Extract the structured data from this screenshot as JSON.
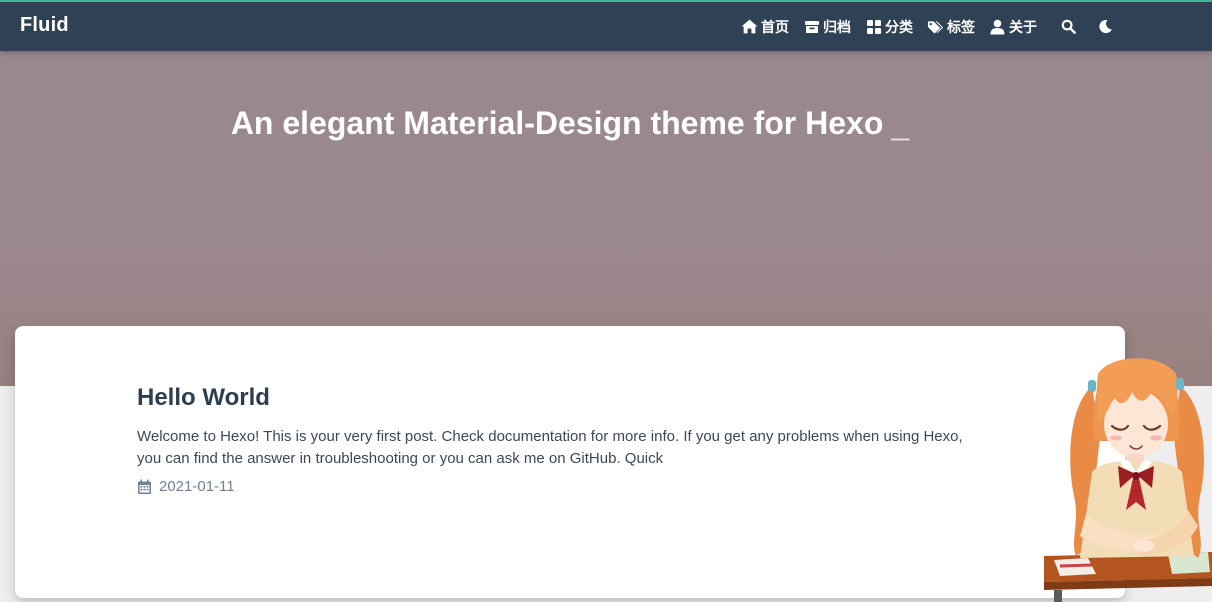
{
  "navbar": {
    "brand": "Fluid",
    "items": [
      {
        "label": "首页",
        "icon": "home-icon"
      },
      {
        "label": "归档",
        "icon": "archive-icon"
      },
      {
        "label": "分类",
        "icon": "category-icon"
      },
      {
        "label": "标签",
        "icon": "tags-icon"
      },
      {
        "label": "关于",
        "icon": "user-icon"
      }
    ],
    "search_icon": "search-icon",
    "darkmode_icon": "moon-icon"
  },
  "banner": {
    "subtitle": "An elegant Material-Design theme for Hexo",
    "cursor": "_"
  },
  "posts": [
    {
      "title": "Hello World",
      "excerpt": "Welcome to Hexo! This is your very first post. Check documentation for more info. If you get any problems when using Hexo, you can find the answer in troubleshooting or you can ask me on GitHub. Quick",
      "date": "2021-01-11",
      "date_icon": "calendar-icon"
    }
  ],
  "colors": {
    "navbar": "#2f4154",
    "navbar_accent": "#3fb69a",
    "banner": "#9a8890",
    "title": "#2c3e50",
    "text": "#3c4858",
    "meta": "#718096"
  }
}
